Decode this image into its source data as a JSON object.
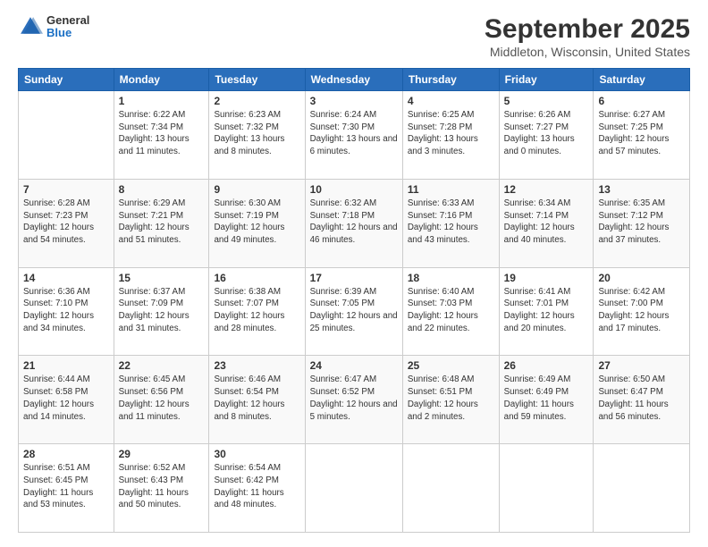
{
  "header": {
    "logo_general": "General",
    "logo_blue": "Blue",
    "month_title": "September 2025",
    "location": "Middleton, Wisconsin, United States"
  },
  "weekdays": [
    "Sunday",
    "Monday",
    "Tuesday",
    "Wednesday",
    "Thursday",
    "Friday",
    "Saturday"
  ],
  "weeks": [
    [
      {
        "day": "",
        "sunrise": "",
        "sunset": "",
        "daylight": ""
      },
      {
        "day": "1",
        "sunrise": "Sunrise: 6:22 AM",
        "sunset": "Sunset: 7:34 PM",
        "daylight": "Daylight: 13 hours and 11 minutes."
      },
      {
        "day": "2",
        "sunrise": "Sunrise: 6:23 AM",
        "sunset": "Sunset: 7:32 PM",
        "daylight": "Daylight: 13 hours and 8 minutes."
      },
      {
        "day": "3",
        "sunrise": "Sunrise: 6:24 AM",
        "sunset": "Sunset: 7:30 PM",
        "daylight": "Daylight: 13 hours and 6 minutes."
      },
      {
        "day": "4",
        "sunrise": "Sunrise: 6:25 AM",
        "sunset": "Sunset: 7:28 PM",
        "daylight": "Daylight: 13 hours and 3 minutes."
      },
      {
        "day": "5",
        "sunrise": "Sunrise: 6:26 AM",
        "sunset": "Sunset: 7:27 PM",
        "daylight": "Daylight: 13 hours and 0 minutes."
      },
      {
        "day": "6",
        "sunrise": "Sunrise: 6:27 AM",
        "sunset": "Sunset: 7:25 PM",
        "daylight": "Daylight: 12 hours and 57 minutes."
      }
    ],
    [
      {
        "day": "7",
        "sunrise": "Sunrise: 6:28 AM",
        "sunset": "Sunset: 7:23 PM",
        "daylight": "Daylight: 12 hours and 54 minutes."
      },
      {
        "day": "8",
        "sunrise": "Sunrise: 6:29 AM",
        "sunset": "Sunset: 7:21 PM",
        "daylight": "Daylight: 12 hours and 51 minutes."
      },
      {
        "day": "9",
        "sunrise": "Sunrise: 6:30 AM",
        "sunset": "Sunset: 7:19 PM",
        "daylight": "Daylight: 12 hours and 49 minutes."
      },
      {
        "day": "10",
        "sunrise": "Sunrise: 6:32 AM",
        "sunset": "Sunset: 7:18 PM",
        "daylight": "Daylight: 12 hours and 46 minutes."
      },
      {
        "day": "11",
        "sunrise": "Sunrise: 6:33 AM",
        "sunset": "Sunset: 7:16 PM",
        "daylight": "Daylight: 12 hours and 43 minutes."
      },
      {
        "day": "12",
        "sunrise": "Sunrise: 6:34 AM",
        "sunset": "Sunset: 7:14 PM",
        "daylight": "Daylight: 12 hours and 40 minutes."
      },
      {
        "day": "13",
        "sunrise": "Sunrise: 6:35 AM",
        "sunset": "Sunset: 7:12 PM",
        "daylight": "Daylight: 12 hours and 37 minutes."
      }
    ],
    [
      {
        "day": "14",
        "sunrise": "Sunrise: 6:36 AM",
        "sunset": "Sunset: 7:10 PM",
        "daylight": "Daylight: 12 hours and 34 minutes."
      },
      {
        "day": "15",
        "sunrise": "Sunrise: 6:37 AM",
        "sunset": "Sunset: 7:09 PM",
        "daylight": "Daylight: 12 hours and 31 minutes."
      },
      {
        "day": "16",
        "sunrise": "Sunrise: 6:38 AM",
        "sunset": "Sunset: 7:07 PM",
        "daylight": "Daylight: 12 hours and 28 minutes."
      },
      {
        "day": "17",
        "sunrise": "Sunrise: 6:39 AM",
        "sunset": "Sunset: 7:05 PM",
        "daylight": "Daylight: 12 hours and 25 minutes."
      },
      {
        "day": "18",
        "sunrise": "Sunrise: 6:40 AM",
        "sunset": "Sunset: 7:03 PM",
        "daylight": "Daylight: 12 hours and 22 minutes."
      },
      {
        "day": "19",
        "sunrise": "Sunrise: 6:41 AM",
        "sunset": "Sunset: 7:01 PM",
        "daylight": "Daylight: 12 hours and 20 minutes."
      },
      {
        "day": "20",
        "sunrise": "Sunrise: 6:42 AM",
        "sunset": "Sunset: 7:00 PM",
        "daylight": "Daylight: 12 hours and 17 minutes."
      }
    ],
    [
      {
        "day": "21",
        "sunrise": "Sunrise: 6:44 AM",
        "sunset": "Sunset: 6:58 PM",
        "daylight": "Daylight: 12 hours and 14 minutes."
      },
      {
        "day": "22",
        "sunrise": "Sunrise: 6:45 AM",
        "sunset": "Sunset: 6:56 PM",
        "daylight": "Daylight: 12 hours and 11 minutes."
      },
      {
        "day": "23",
        "sunrise": "Sunrise: 6:46 AM",
        "sunset": "Sunset: 6:54 PM",
        "daylight": "Daylight: 12 hours and 8 minutes."
      },
      {
        "day": "24",
        "sunrise": "Sunrise: 6:47 AM",
        "sunset": "Sunset: 6:52 PM",
        "daylight": "Daylight: 12 hours and 5 minutes."
      },
      {
        "day": "25",
        "sunrise": "Sunrise: 6:48 AM",
        "sunset": "Sunset: 6:51 PM",
        "daylight": "Daylight: 12 hours and 2 minutes."
      },
      {
        "day": "26",
        "sunrise": "Sunrise: 6:49 AM",
        "sunset": "Sunset: 6:49 PM",
        "daylight": "Daylight: 11 hours and 59 minutes."
      },
      {
        "day": "27",
        "sunrise": "Sunrise: 6:50 AM",
        "sunset": "Sunset: 6:47 PM",
        "daylight": "Daylight: 11 hours and 56 minutes."
      }
    ],
    [
      {
        "day": "28",
        "sunrise": "Sunrise: 6:51 AM",
        "sunset": "Sunset: 6:45 PM",
        "daylight": "Daylight: 11 hours and 53 minutes."
      },
      {
        "day": "29",
        "sunrise": "Sunrise: 6:52 AM",
        "sunset": "Sunset: 6:43 PM",
        "daylight": "Daylight: 11 hours and 50 minutes."
      },
      {
        "day": "30",
        "sunrise": "Sunrise: 6:54 AM",
        "sunset": "Sunset: 6:42 PM",
        "daylight": "Daylight: 11 hours and 48 minutes."
      },
      {
        "day": "",
        "sunrise": "",
        "sunset": "",
        "daylight": ""
      },
      {
        "day": "",
        "sunrise": "",
        "sunset": "",
        "daylight": ""
      },
      {
        "day": "",
        "sunrise": "",
        "sunset": "",
        "daylight": ""
      },
      {
        "day": "",
        "sunrise": "",
        "sunset": "",
        "daylight": ""
      }
    ]
  ]
}
